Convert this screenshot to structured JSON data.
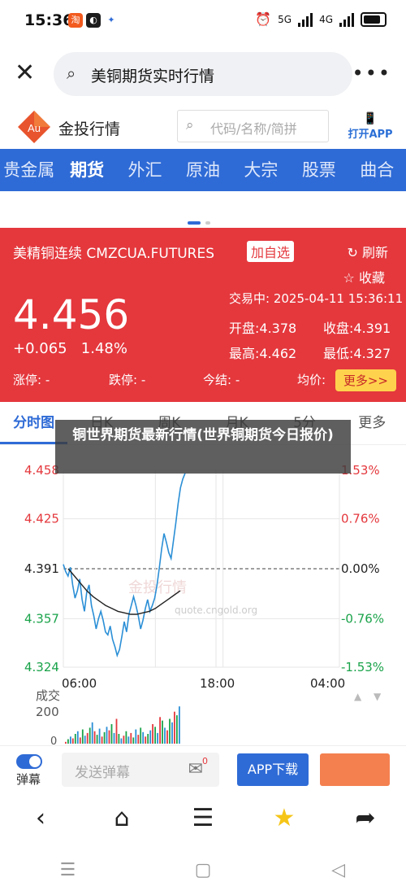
{
  "status": {
    "time": "15:36",
    "net_left": "5G",
    "net_right": "4G"
  },
  "browser": {
    "query": "美铜期货实时行情"
  },
  "site": {
    "name": "金投行情",
    "logo_text": "Au",
    "search_placeholder": "代码/名称/简拼",
    "open_app": "打开APP"
  },
  "nav": {
    "tabs": [
      "贵金属",
      "期货",
      "外汇",
      "原油",
      "大宗",
      "股票",
      "曲合"
    ],
    "active_index": 1
  },
  "quote": {
    "name": "美精铜连续 CMZCUA.FUTURES",
    "add_fav": "加自选",
    "refresh": "刷新",
    "collect": "收藏",
    "price": "4.456",
    "change": "+0.065",
    "change_pct": "1.48%",
    "trade_time": "交易中: 2025-04-11 15:36:11",
    "open": "开盘:4.378",
    "prev_close": "收盘:4.391",
    "high": "最高:4.462",
    "low": "最低:4.327",
    "limit_up": "涨停: -",
    "limit_down": "跌停: -",
    "settle": "今结: -",
    "avg": "均价:",
    "more": "更多>>"
  },
  "chart_tabs": [
    "分时图",
    "日K",
    "周K",
    "月K",
    "5分",
    "更多"
  ],
  "overlay_title": "铜世界期货最新行情(世界铜期货今日报价)",
  "chart_data": {
    "type": "line",
    "y_left_ticks": [
      "4.458",
      "4.425",
      "4.391",
      "4.357",
      "4.324"
    ],
    "y_right_ticks": [
      "1.53%",
      "0.76%",
      "0.00%",
      "-0.76%",
      "-1.53%"
    ],
    "x_ticks": [
      "06:00",
      "18:00",
      "04:00"
    ],
    "ylim": [
      4.324,
      4.458
    ],
    "baseline": 4.391,
    "watermark": "金投行情",
    "watermark_url": "quote.cngold.org",
    "volume_label": "成交",
    "volume_tick": "200",
    "volume_zero": "0",
    "price_series": [
      4.394,
      4.389,
      4.386,
      4.392,
      4.38,
      4.371,
      4.376,
      4.384,
      4.37,
      4.362,
      4.375,
      4.38,
      4.366,
      4.359,
      4.35,
      4.357,
      4.362,
      4.356,
      4.348,
      4.346,
      4.352,
      4.343,
      4.338,
      4.332,
      4.336,
      4.345,
      4.355,
      4.348,
      4.36,
      4.366,
      4.372,
      4.366,
      4.359,
      4.35,
      4.356,
      4.364,
      4.37,
      4.362,
      4.366,
      4.371,
      4.38,
      4.392,
      4.405,
      4.415,
      4.409,
      4.402,
      4.398,
      4.41,
      4.422,
      4.435,
      4.446,
      4.452,
      4.456
    ],
    "avg_series": [
      4.391,
      4.386,
      4.381,
      4.376,
      4.372,
      4.369,
      4.366,
      4.364,
      4.362,
      4.361,
      4.36,
      4.36,
      4.361,
      4.362,
      4.364,
      4.367,
      4.37,
      4.373,
      4.376
    ],
    "volume_series": [
      10,
      25,
      40,
      30,
      55,
      70,
      35,
      80,
      45,
      60,
      90,
      120,
      70,
      50,
      85,
      40,
      65,
      95,
      75,
      110,
      60,
      140,
      55,
      30,
      45,
      70,
      40,
      60,
      35,
      80,
      50,
      90,
      65,
      40,
      55,
      75,
      110,
      95,
      60,
      150,
      130,
      90,
      75,
      140,
      120,
      180,
      160,
      210
    ]
  },
  "action": {
    "toggle_label": "弹幕",
    "danmu_placeholder": "发送弹幕",
    "badge": "0",
    "app_download": "APP下载"
  },
  "bottom_nav": [
    "back-icon",
    "home-icon",
    "menu-icon",
    "star-icon",
    "share-icon"
  ],
  "colors": {
    "brand_blue": "#2f6bd6",
    "quote_red": "#e4383d",
    "up_red": "#e4383d",
    "down_green": "#1aa34a"
  }
}
